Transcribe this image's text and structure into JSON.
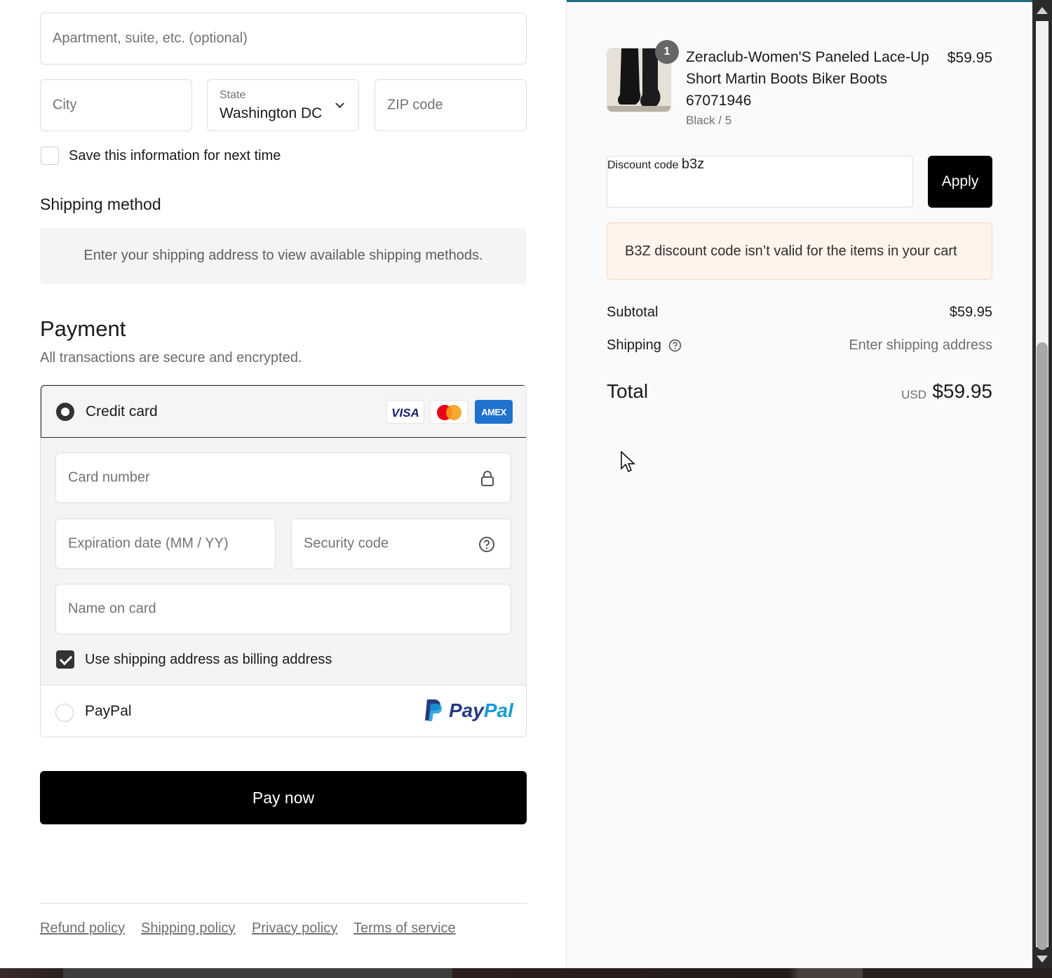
{
  "address": {
    "apartment_placeholder": "Apartment, suite, etc. (optional)",
    "city_placeholder": "City",
    "state_label": "State",
    "state_value": "Washington DC",
    "zip_placeholder": "ZIP code",
    "save_info_label": "Save this information for next time"
  },
  "shipping_method": {
    "title": "Shipping method",
    "notice": "Enter your shipping address to view available shipping methods."
  },
  "payment": {
    "title": "Payment",
    "subtitle": "All transactions are secure and encrypted.",
    "credit_card_label": "Credit card",
    "card_brands": [
      "VISA",
      "AMEX"
    ],
    "card_number_placeholder": "Card number",
    "expiration_placeholder": "Expiration date (MM / YY)",
    "security_code_placeholder": "Security code",
    "name_on_card_placeholder": "Name on card",
    "billing_same_label": "Use shipping address as billing address",
    "billing_same_checked": true,
    "paypal_label": "PayPal",
    "paypal_logo_a": "Pay",
    "paypal_logo_b": "Pal",
    "pay_button": "Pay now"
  },
  "footer": {
    "links": [
      "Refund policy",
      "Shipping policy",
      "Privacy policy",
      "Terms of service"
    ]
  },
  "order": {
    "item": {
      "quantity": "1",
      "title_line1": "Zeraclub-Women'S Paneled Lace-Up",
      "title_line2": "Short Martin Boots Biker Boots",
      "title_line3": "67071946",
      "variant": "Black / 5",
      "price": "$59.95"
    },
    "discount": {
      "label": "Discount code",
      "value": "b3z",
      "apply_button": "Apply",
      "error": "B3Z discount code isn’t valid for the items in your cart"
    },
    "subtotal_label": "Subtotal",
    "subtotal_value": "$59.95",
    "shipping_label": "Shipping",
    "shipping_value": "Enter shipping address",
    "total_label": "Total",
    "total_currency": "USD",
    "total_value": "$59.95"
  },
  "colors": {
    "accent": "#000000",
    "warning_bg": "#fff4eb",
    "paypal_dark": "#253b80",
    "paypal_light": "#179bd7"
  }
}
